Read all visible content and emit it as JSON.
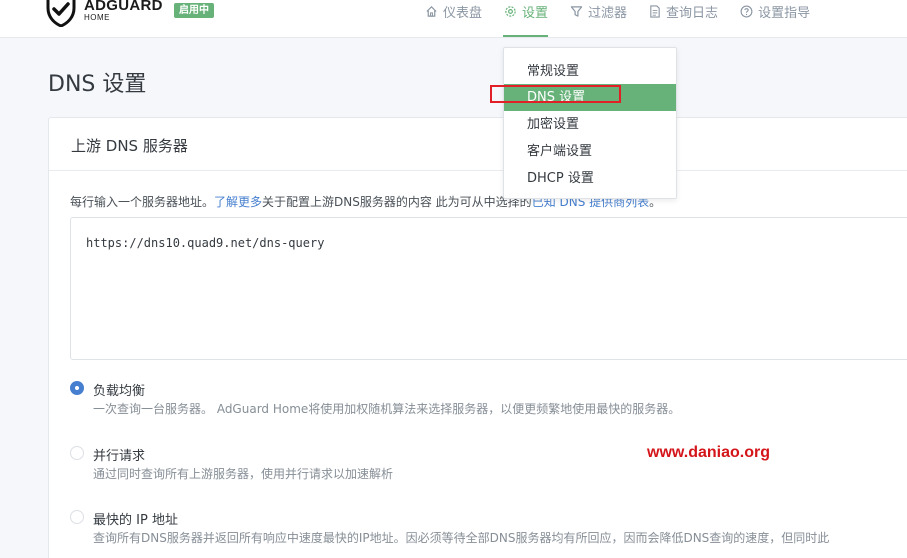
{
  "header": {
    "logo": {
      "main": "ADGUARD",
      "sub": "HOME"
    },
    "status_badge": "启用中",
    "nav": [
      {
        "label": "仪表盘",
        "icon": "home-icon"
      },
      {
        "label": "设置",
        "icon": "gear-icon",
        "active": true
      },
      {
        "label": "过滤器",
        "icon": "filter-icon"
      },
      {
        "label": "查询日志",
        "icon": "document-icon"
      },
      {
        "label": "设置指导",
        "icon": "help-circle-icon"
      }
    ]
  },
  "page": {
    "title": "DNS 设置"
  },
  "dropdown": {
    "items": [
      {
        "label": "常规设置"
      },
      {
        "label": "DNS 设置",
        "active": true
      },
      {
        "label": "加密设置"
      },
      {
        "label": "客户端设置"
      },
      {
        "label": "DHCP 设置"
      }
    ]
  },
  "upstream": {
    "card_title": "上游 DNS 服务器",
    "desc_prefix": "每行输入一个服务器地址。",
    "desc_link": "了解更多",
    "desc_middle": "关于配置上游DNS服务器的内容 此为可从中选择的",
    "desc_link2": "已知 DNS 提供商列表",
    "desc_suffix": "。",
    "servers": "https://dns10.quad9.net/dns-query"
  },
  "options": [
    {
      "label": "负载均衡",
      "desc": "一次查询一台服务器。 AdGuard Home将使用加权随机算法来选择服务器，以便更频繁地使用最快的服务器。",
      "checked": true
    },
    {
      "label": "并行请求",
      "desc": "通过同时查询所有上游服务器，使用并行请求以加速解析",
      "checked": false
    },
    {
      "label": "最快的 IP 地址",
      "desc": "查询所有DNS服务器并返回所有响应中速度最快的IP地址。因必须等待全部DNS服务器均有所回应，因而会降低DNS查询的速度，但同时此",
      "checked": false
    }
  ],
  "watermark": "www.daniao.org",
  "colors": {
    "accent": "#67b279",
    "link": "#467fcf",
    "watermark": "#d4151a",
    "highlight": "#e01f26"
  }
}
